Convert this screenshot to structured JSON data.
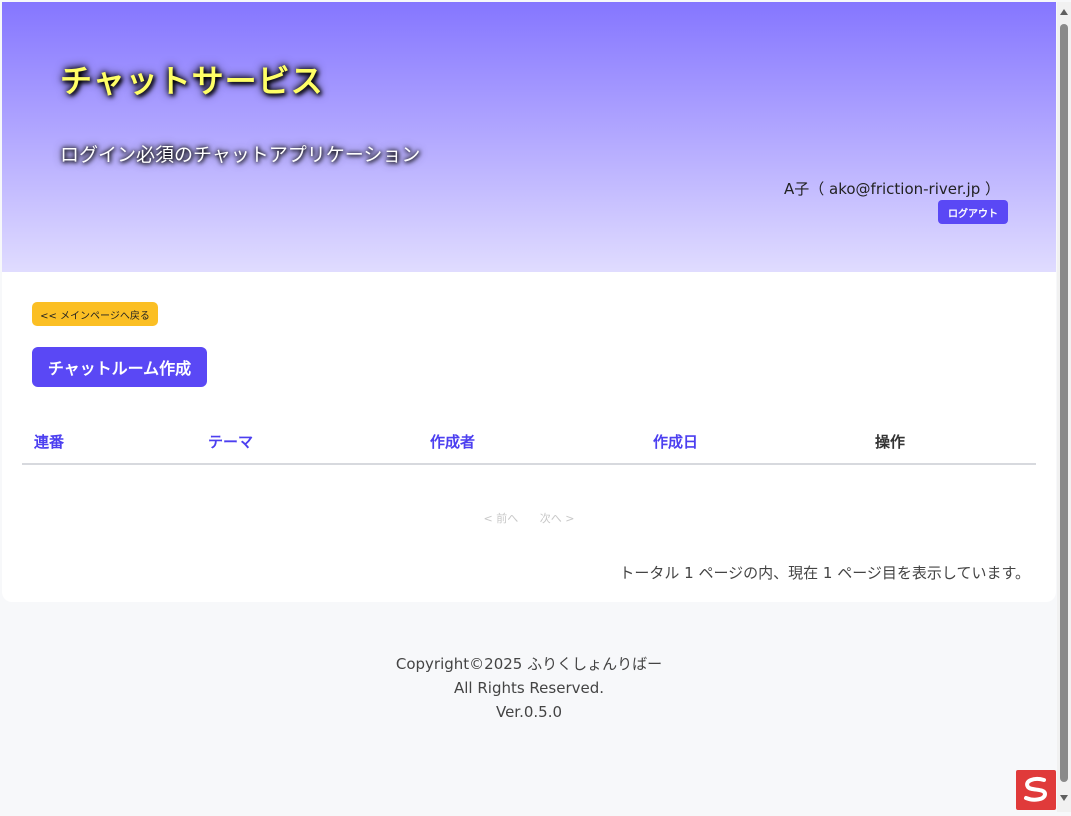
{
  "header": {
    "title": "チャットサービス",
    "subtitle": "ログイン必須のチャットアプリケーション",
    "user": "A子（ ako@friction-river.jp ）",
    "logout_label": "ログアウト"
  },
  "main": {
    "back_label": "<< メインページへ戻る",
    "create_label": "チャットルーム作成",
    "table": {
      "columns": [
        "連番",
        "テーマ",
        "作成者",
        "作成日",
        "操作"
      ]
    },
    "pager": {
      "prev_label": "< 前へ",
      "next_label": "次へ >"
    },
    "page_status": "トータル 1 ページの内、現在 1 ページ目を表示しています。"
  },
  "footer": {
    "copyright": "Copyright©2025 ふりくしょんりばー",
    "rights": "All Rights Reserved.",
    "version": "Ver.0.5.0"
  },
  "colors": {
    "accent": "#5a48f5",
    "back_button": "#fbbf24",
    "title": "#ffff66"
  },
  "icons": {
    "corner_badge": "app-badge-icon"
  }
}
